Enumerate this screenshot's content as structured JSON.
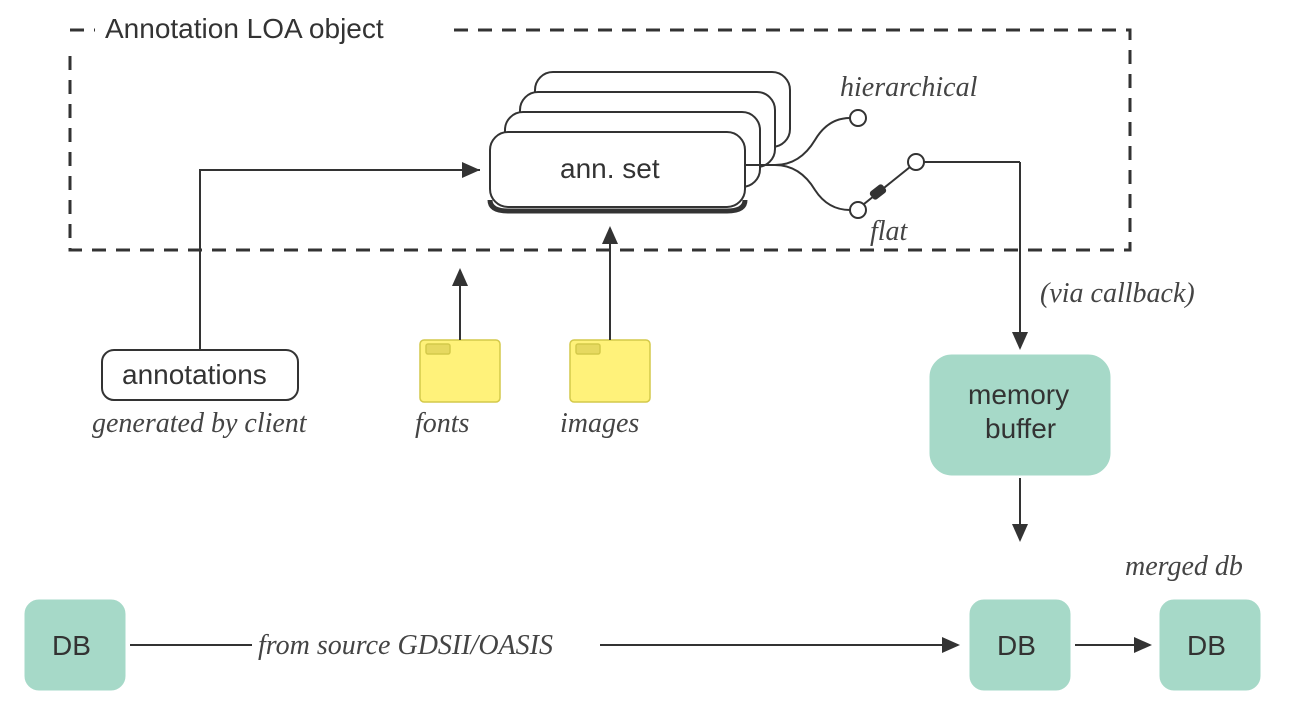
{
  "container": {
    "title": "Annotation LOA object"
  },
  "nodes": {
    "annSet": "ann. set",
    "annotations": "annotations",
    "annotationsSub": "generated by client",
    "fonts": "fonts",
    "images": "images",
    "hierarchical": "hierarchical",
    "flat": "flat",
    "viaCallback": "(via callback)",
    "memoryBuffer1": "memory",
    "memoryBuffer2": "buffer",
    "dbLeft": "DB",
    "dbMid": "DB",
    "dbRight": "DB",
    "mergedDb": "merged db",
    "fromSource": "from source GDSII/OASIS"
  }
}
